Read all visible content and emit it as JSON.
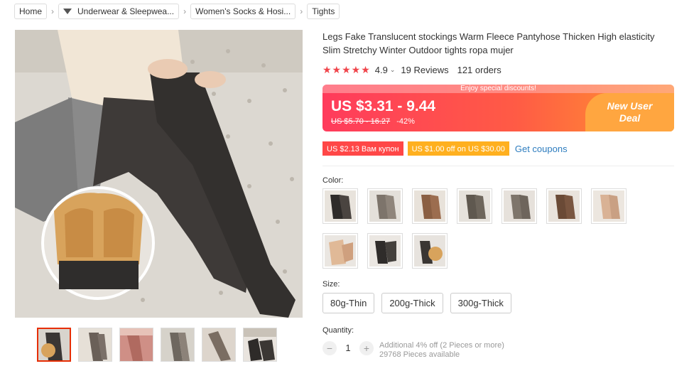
{
  "breadcrumb": {
    "items": [
      {
        "label": "Home"
      },
      {
        "label": "Underwear & Sleepwea..."
      },
      {
        "label": "Women's Socks & Hosi..."
      },
      {
        "label": "Tights"
      }
    ]
  },
  "product": {
    "title": "Legs Fake Translucent stockings Warm Fleece Pantyhose Thicken High elasticity Slim Stretchy Winter Outdoor tights ropa mujer",
    "rating": "4.9",
    "stars": "★★★★★",
    "reviews": "19 Reviews",
    "orders": "121 orders"
  },
  "price": {
    "banner": "Enjoy special discounts!",
    "current": "US $3.31 - 9.44",
    "original": "US $5.70 - 16.27",
    "discount": "-42%",
    "promo_line1": "New User",
    "promo_line2": "Deal"
  },
  "coupons": {
    "c1": "US $2.13 Вам купон",
    "c2": "US $1.00 off on US $30.00",
    "get": "Get coupons"
  },
  "colors": {
    "label": "Color:"
  },
  "sizes": {
    "label": "Size:",
    "options": [
      "80g-Thin",
      "200g-Thick",
      "300g-Thick"
    ]
  },
  "quantity": {
    "label": "Quantity:",
    "value": "1",
    "minus": "−",
    "plus": "+",
    "info1": "Additional 4% off (2 Pieces or more)",
    "info2": "29768 Pieces available"
  }
}
